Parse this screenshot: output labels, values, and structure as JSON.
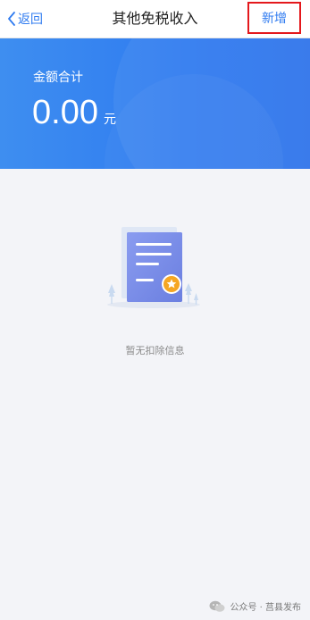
{
  "nav": {
    "back_label": "返回",
    "title": "其他免税收入",
    "add_label": "新增"
  },
  "summary": {
    "label": "金额合计",
    "amount": "0.00",
    "unit": "元"
  },
  "empty": {
    "message": "暂无扣除信息"
  },
  "watermark": {
    "text": "公众号 · 莒县发布"
  },
  "colors": {
    "accent": "#2f7bf0",
    "banner_start": "#3e8ef0",
    "banner_end": "#2e73ea",
    "highlight_border": "#e4181c",
    "background": "#f3f4f8"
  },
  "icons": {
    "back": "chevron-left-icon",
    "empty": "document-empty-icon",
    "watermark": "wechat-icon"
  }
}
